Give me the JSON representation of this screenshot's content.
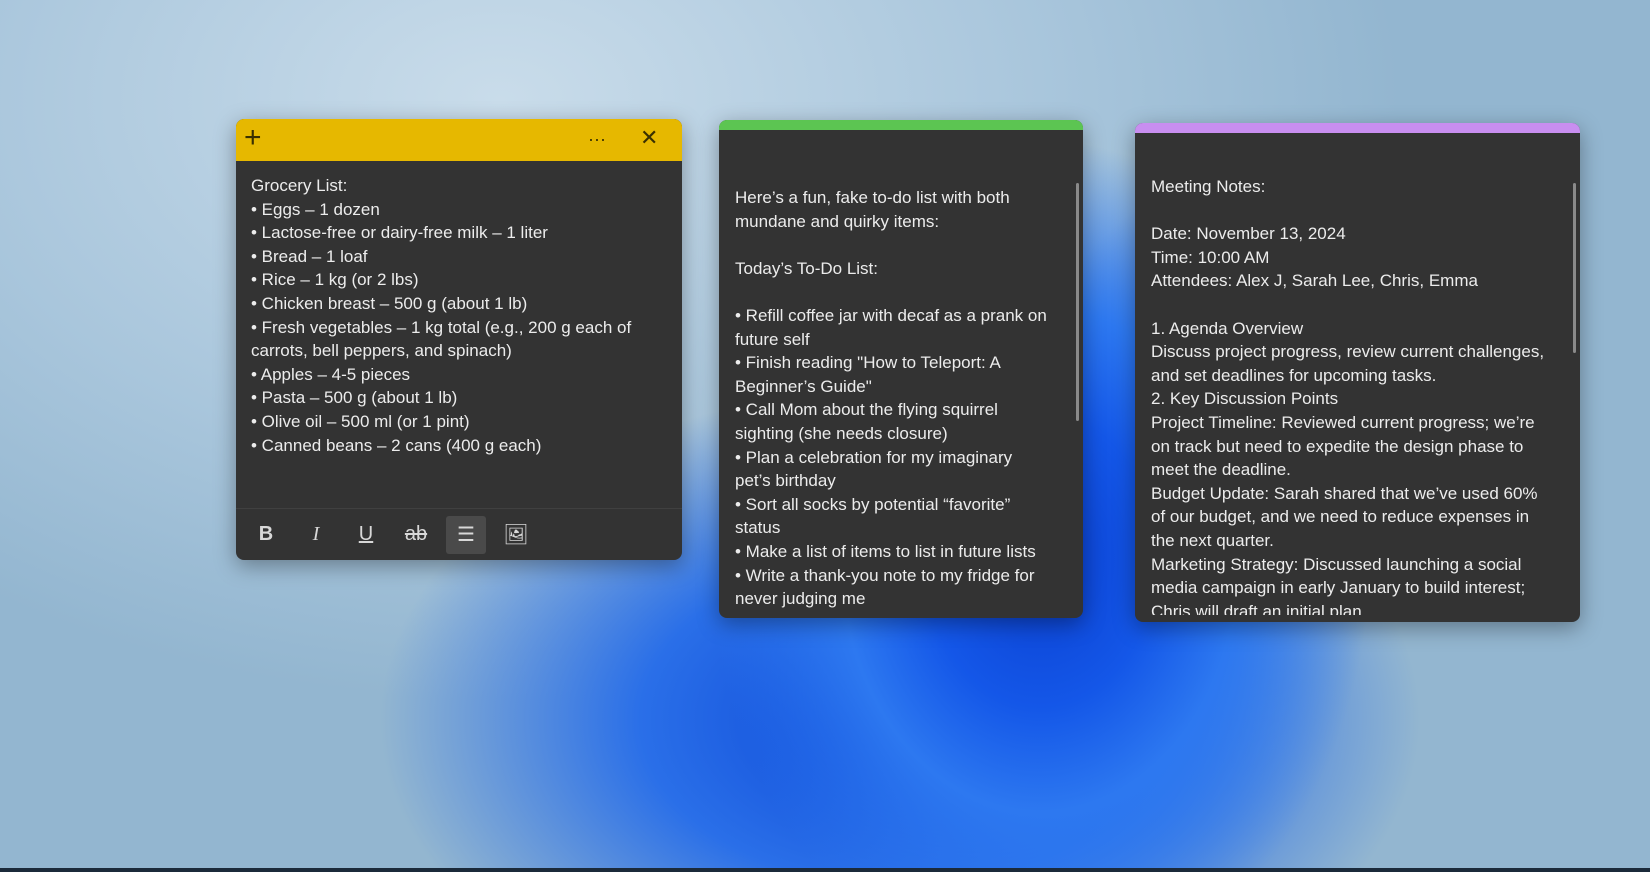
{
  "notes": [
    {
      "color": "#e6b800",
      "header": {
        "add_icon": "+",
        "menu_icon": "···",
        "close_icon": "✕"
      },
      "lines": [
        "Grocery List:",
        "• Eggs – 1 dozen",
        "• Lactose-free or dairy-free milk – 1 liter",
        "• Bread – 1 loaf",
        "• Rice – 1 kg (or 2 lbs)",
        "• Chicken breast – 500 g (about 1 lb)",
        "• Fresh vegetables – 1 kg total (e.g., 200 g each of",
        "carrots, bell peppers, and spinach)",
        "• Apples – 4-5 pieces",
        "• Pasta – 500 g (about 1 lb)",
        "• Olive oil – 500 ml (or 1 pint)",
        "• Canned beans – 2 cans (400 g each)"
      ],
      "toolbar": {
        "bold": "B",
        "italic": "I",
        "underline": "U",
        "strikethrough": "ab",
        "bullets": "☰",
        "image": "🖼"
      }
    },
    {
      "color": "#5cc552",
      "lines": [
        "Here’s a fun, fake to-do list with both",
        "mundane and quirky items:",
        "",
        "Today’s To-Do List:",
        "",
        "• Refill coffee jar with decaf as a prank on",
        "future self",
        "• Finish reading \"How to Teleport: A",
        "Beginner’s Guide\"",
        "• Call Mom about the flying squirrel",
        "sighting (she needs closure)",
        "• Plan a celebration for my imaginary",
        "pet’s birthday",
        "• Sort all socks by potential “favorite”",
        "status",
        "• Make a list of items to list in future lists",
        "• Write a thank-you note to my fridge for",
        "never judging me"
      ]
    },
    {
      "color": "#c88ef0",
      "lines": [
        "Meeting Notes:",
        "",
        "Date: November 13, 2024",
        "Time: 10:00 AM",
        "Attendees: Alex J, Sarah Lee, Chris, Emma",
        "",
        "1. Agenda Overview",
        "Discuss project progress, review current challenges,",
        "and set deadlines for upcoming tasks.",
        "2. Key Discussion Points",
        "Project Timeline: Reviewed current progress; we’re",
        "on track but need to expedite the design phase to",
        "meet the deadline.",
        "Budget Update: Sarah shared that we’ve used 60%",
        "of our budget, and we need to reduce expenses in",
        "the next quarter.",
        "Marketing Strategy: Discussed launching a social",
        "media campaign in early January to build interest;",
        "Chris will draft an initial plan."
      ]
    }
  ]
}
